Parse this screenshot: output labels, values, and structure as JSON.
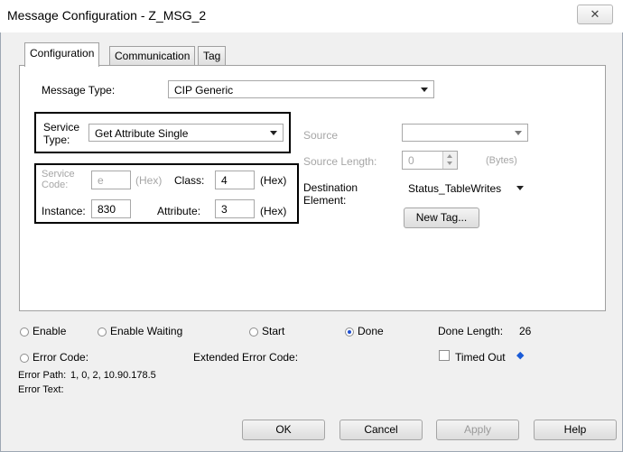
{
  "window": {
    "title": "Message Configuration - Z_MSG_2",
    "close_symbol": "✕"
  },
  "tabs": [
    {
      "label": "Configuration"
    },
    {
      "label": "Communication"
    },
    {
      "label": "Tag"
    }
  ],
  "config": {
    "message_type_label": "Message Type:",
    "message_type_value": "CIP Generic",
    "service_type_label_1": "Service",
    "service_type_label_2": "Type:",
    "service_type_value": "Get Attribute Single",
    "service_code_label_1": "Service",
    "service_code_label_2": "Code:",
    "service_code_value": "e",
    "hex_label": "(Hex)",
    "class_label": "Class:",
    "class_value": "4",
    "instance_label": "Instance:",
    "instance_value": "830",
    "attribute_label": "Attribute:",
    "attribute_value": "3",
    "source_label": "Source",
    "source_value": "",
    "source_length_label": "Source Length:",
    "source_length_value": "0",
    "bytes_label": "(Bytes)",
    "destination_label_1": "Destination",
    "destination_label_2": "Element:",
    "destination_value": "Status_TableWrites",
    "new_tag_button": "New Tag..."
  },
  "status": {
    "enable": "Enable",
    "enable_waiting": "Enable Waiting",
    "start": "Start",
    "done": "Done",
    "done_length_label": "Done Length:",
    "done_length_value": "26",
    "error_code": "Error Code:",
    "extended_error_code": "Extended Error Code:",
    "timed_out": "Timed Out",
    "timed_out_arrow": "◆",
    "error_path_label": "Error Path:",
    "error_path_value": "1, 0, 2, 10.90.178.5",
    "error_text_label": "Error Text:"
  },
  "buttons": {
    "ok": "OK",
    "cancel": "Cancel",
    "apply": "Apply",
    "help": "Help"
  },
  "colors": {
    "accent_radio": "#1f4fd0",
    "arrow_blue": "#1a5bd7",
    "highlight_box": "#000000"
  }
}
